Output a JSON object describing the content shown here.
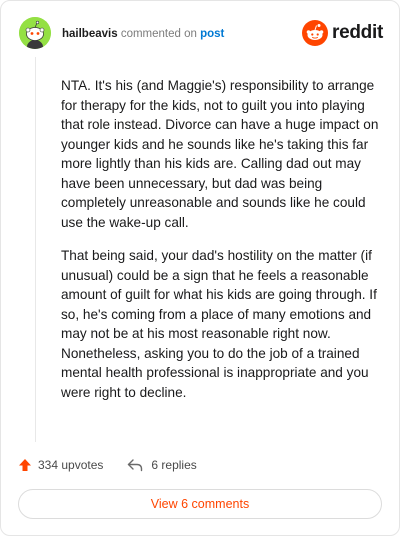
{
  "header": {
    "username": "hailbeavis",
    "action_text": "commented on",
    "post_link_text": "post",
    "logo_text": "reddit"
  },
  "comment": {
    "paragraphs": [
      "NTA. It's his (and Maggie's) responsibility to arrange for therapy for the kids, not to guilt you into playing that role instead. Divorce can have a huge impact on younger kids and he sounds like he's taking this far more lightly than his kids are. Calling dad out may have been unnecessary, but dad was being completely unreasonable and sounds like he could use the wake-up call.",
      "That being said, your dad's hostility on the matter (if unusual) could be a sign that he feels a reasonable amount of guilt for what his kids are going through. If so, he's coming from a place of many emotions and may not be at his most reasonable right now. Nonetheless, asking you to do the job of a trained mental health professional is inappropriate and you were right to decline."
    ]
  },
  "actions": {
    "upvotes": "334 upvotes",
    "replies": "6 replies"
  },
  "footer": {
    "view_button": "View 6 comments"
  },
  "colors": {
    "accent": "#ff4500",
    "link": "#0079d3",
    "avatar_bg": "#94e044"
  },
  "icons": {
    "avatar": "snoo-avatar-icon",
    "logo": "reddit-snoo-icon",
    "upvote": "upvote-arrow-icon",
    "reply": "reply-arrow-icon"
  }
}
